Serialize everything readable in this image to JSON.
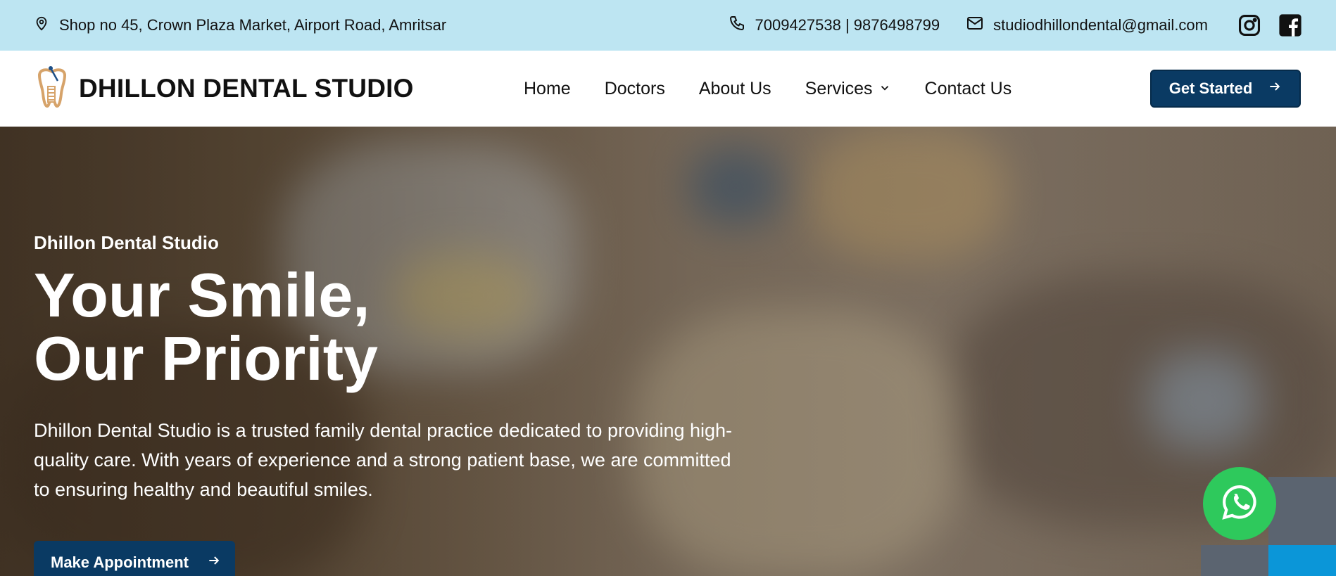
{
  "topbar": {
    "address": "Shop no 45, Crown Plaza Market, Airport Road, Amritsar",
    "phones": "7009427538 | 9876498799",
    "email": "studiodhillondental@gmail.com",
    "social_icons": [
      "instagram-icon",
      "facebook-icon"
    ],
    "background": "#bde5f2"
  },
  "nav": {
    "brand": "DHILLON DENTAL STUDIO",
    "menu": [
      {
        "label": "Home"
      },
      {
        "label": "Doctors"
      },
      {
        "label": "About Us"
      },
      {
        "label": "Services"
      },
      {
        "label": "Contact Us"
      }
    ],
    "cta_label": "Get Started"
  },
  "hero": {
    "eyebrow": "Dhillon Dental Studio",
    "headline_line1": "Your Smile,",
    "headline_line2": "Our Priority",
    "description": "Dhillon Dental Studio is a trusted family dental practice dedicated to providing high-quality care. With years of experience and a strong patient base, we are committed to ensuring healthy and beautiful smiles.",
    "button_label": "Make Appointment"
  },
  "colors": {
    "primary_button": "#0a3a63",
    "whatsapp": "#2ec95c"
  }
}
